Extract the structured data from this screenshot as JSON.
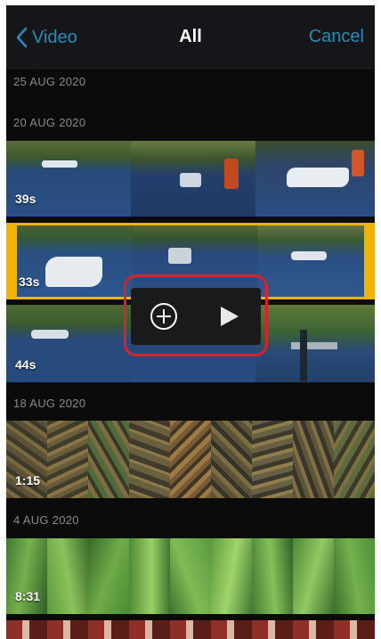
{
  "navbar": {
    "back_label": "Video",
    "title": "All",
    "cancel_label": "Cancel"
  },
  "sections": [
    {
      "date": "25 AUG 2020",
      "clips": []
    },
    {
      "date": "20 AUG 2020",
      "clips": [
        {
          "duration": "39s",
          "selected": false,
          "theme": "lake-boats"
        },
        {
          "duration": "33s",
          "selected": true,
          "theme": "lake-boats"
        },
        {
          "duration": "44s",
          "selected": false,
          "theme": "lake-dock"
        }
      ]
    },
    {
      "date": "18 AUG 2020",
      "clips": [
        {
          "duration": "1:15",
          "selected": false,
          "theme": "ground-leaves"
        }
      ]
    },
    {
      "date": "4 AUG 2020",
      "clips": [
        {
          "duration": "8:31",
          "selected": false,
          "theme": "green-leaves"
        },
        {
          "duration": "",
          "selected": false,
          "theme": "red-partial"
        }
      ]
    }
  ],
  "popover": {
    "add_icon": "add-circle-icon",
    "play_icon": "play-icon"
  },
  "colors": {
    "accent": "#2a8bb4",
    "selection": "#f1b400",
    "highlight": "#d8232a"
  }
}
